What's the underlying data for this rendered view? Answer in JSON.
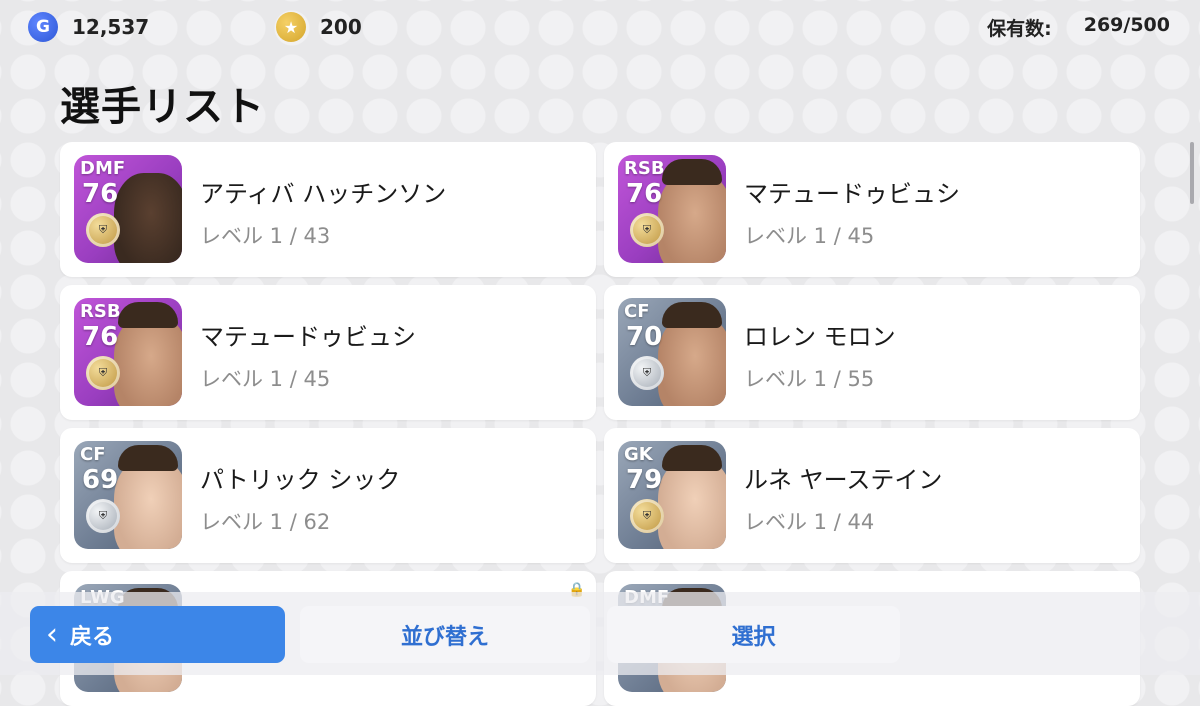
{
  "currency": {
    "gp_icon_glyph": "G",
    "gp_value": "12,537",
    "coins_icon_glyph": "★",
    "coins_value": "200"
  },
  "ownership": {
    "label": "保有数:",
    "value": "269/500"
  },
  "page_title": "選手リスト",
  "players": [
    {
      "position": "DMF",
      "rating": "76",
      "name": "アティバ ハッチンソン",
      "level": "レベル 1 / 43",
      "card_color": "purple",
      "medal": "gold",
      "skin": "dark"
    },
    {
      "position": "RSB",
      "rating": "76",
      "name": "マテュードゥビュシ",
      "level": "レベル 1 / 45",
      "card_color": "purple",
      "medal": "gold",
      "skin": "tan"
    },
    {
      "position": "RSB",
      "rating": "76",
      "name": "マテュードゥビュシ",
      "level": "レベル 1 / 45",
      "card_color": "purple",
      "medal": "gold",
      "skin": "tan"
    },
    {
      "position": "CF",
      "rating": "70",
      "name": "ロレン モロン",
      "level": "レベル 1 / 55",
      "card_color": "slate",
      "medal": "silver",
      "skin": "tan"
    },
    {
      "position": "CF",
      "rating": "69",
      "name": "パトリック シック",
      "level": "レベル 1 / 62",
      "card_color": "slate",
      "medal": "silver",
      "skin": "light"
    },
    {
      "position": "GK",
      "rating": "79",
      "name": "ルネ ヤーステイン",
      "level": "レベル 1 / 44",
      "card_color": "slate",
      "medal": "gold",
      "skin": "light"
    },
    {
      "position": "LWG",
      "rating": "",
      "name": "",
      "level": "",
      "card_color": "slate",
      "medal": "",
      "skin": "light",
      "locked": true
    },
    {
      "position": "DMF",
      "rating": "",
      "name": "",
      "level": "",
      "card_color": "slate",
      "medal": "",
      "skin": "light"
    }
  ],
  "buttons": {
    "back_label": "戻る",
    "back_icon_glyph": "‹",
    "sort_label": "並び替え",
    "select_label": "選択"
  },
  "colors": {
    "accent_blue": "#3c86e8",
    "button_text_blue": "#2f6fd1",
    "epic_purple": "#9a3ec0",
    "standard_slate": "#6f7e94"
  }
}
